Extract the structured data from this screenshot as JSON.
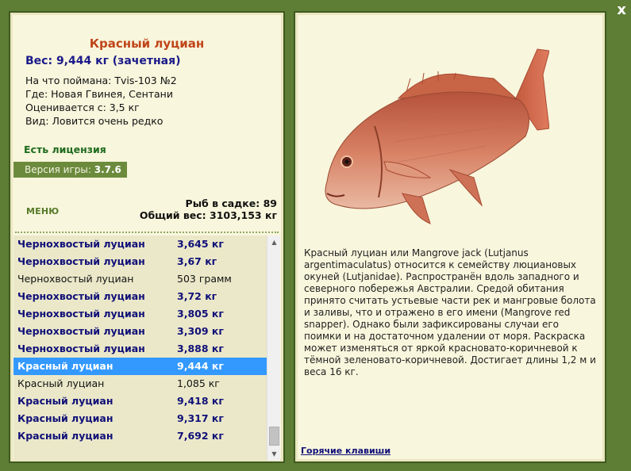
{
  "close_label": "x",
  "fish": {
    "title": "Красный луциан",
    "weight": "Вес: 9,444 кг (зачетная)",
    "info_lines": [
      "На что поймана: Tvis-103 №2",
      "Где: Новая Гвинея, Сентани",
      "Оценивается с: 3,5 кг",
      "Вид: Ловится очень редко"
    ],
    "license": "Есть лицензия",
    "version_label": "Версия игры:",
    "version_value": "3.7.6"
  },
  "menu_label": "МЕНЮ",
  "keep": {
    "count": "Рыб в садке: 89",
    "total": "Общий вес: 3103,153 кг"
  },
  "catch_list": [
    {
      "name": "Чернохвостый луциан",
      "weight": "3,645 кг",
      "style": "bold"
    },
    {
      "name": "Чернохвостый луциан",
      "weight": "3,67 кг",
      "style": "bold"
    },
    {
      "name": "Чернохвостый луциан",
      "weight": "503 грамм",
      "style": "plain"
    },
    {
      "name": "Чернохвостый луциан",
      "weight": "3,72 кг",
      "style": "bold"
    },
    {
      "name": "Чернохвостый луциан",
      "weight": "3,805 кг",
      "style": "bold"
    },
    {
      "name": "Чернохвостый луциан",
      "weight": "3,309 кг",
      "style": "bold"
    },
    {
      "name": "Чернохвостый луциан",
      "weight": "3,888 кг",
      "style": "bold"
    },
    {
      "name": "Красный луциан",
      "weight": "9,444 кг",
      "style": "selected"
    },
    {
      "name": "Красный луциан",
      "weight": "1,085 кг",
      "style": "plain"
    },
    {
      "name": "Красный луциан",
      "weight": "9,418 кг",
      "style": "bold"
    },
    {
      "name": "Красный луциан",
      "weight": "9,317 кг",
      "style": "bold"
    },
    {
      "name": "Красный луциан",
      "weight": "7,692 кг",
      "style": "bold"
    }
  ],
  "description": "Красный луциан или Mangrove jack (Lutjanus argentimaculatus) относится к семейству люциановых окуней (Lutjanidae). Распространён вдоль западного и северного побережья Австралии. Средой обитания принято считать устьевые части рек и мангровые болота и заливы, что и отражено в его имени (Mangrove red snapper). Однако были зафиксированы случаи его поимки и на достаточном удалении от моря. Раскраска может изменяться от яркой красновато-коричневой к тёмной зеленовато-коричневой. Достигает длины 1,2 м и веса 16 кг.",
  "hotkeys_label": "Горячие клавиши",
  "colors": {
    "frame": "#5e7d35",
    "panel": "#f8f6dc",
    "title": "#c0461a",
    "weight_text": "#1a1a8a",
    "license": "#1e6b1e",
    "selected_row": "#3399ff"
  },
  "icons": [
    "close-icon",
    "scroll-up-arrow-icon",
    "scroll-down-arrow-icon"
  ]
}
